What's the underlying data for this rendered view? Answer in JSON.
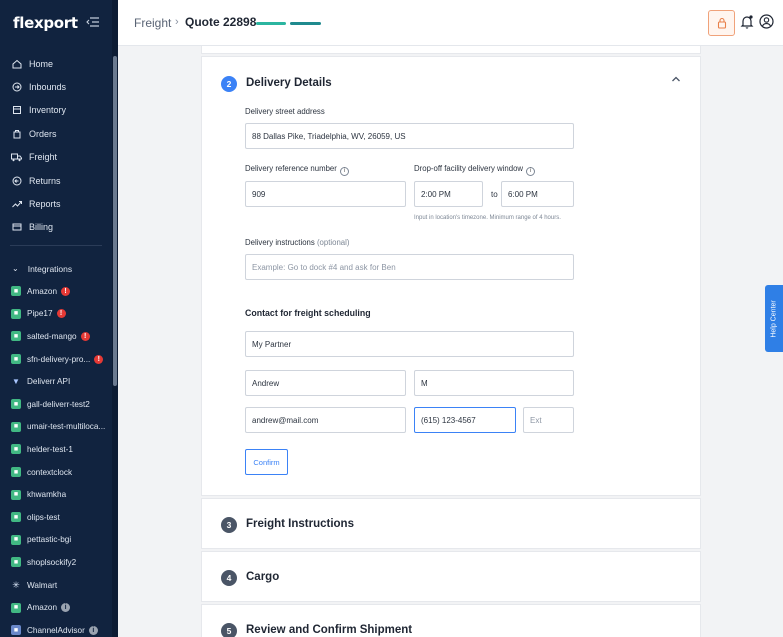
{
  "app": {
    "logo": "flexport"
  },
  "colors": {
    "sidebar": "#11233f",
    "accent": "#3b82f6",
    "progress": "#2bb5a0",
    "error": "#e53935"
  },
  "nav": {
    "items": [
      {
        "label": "Home",
        "icon": "home-icon"
      },
      {
        "label": "Inbounds",
        "icon": "inbound-icon"
      },
      {
        "label": "Inventory",
        "icon": "inventory-icon"
      },
      {
        "label": "Orders",
        "icon": "orders-icon"
      },
      {
        "label": "Freight",
        "icon": "truck-icon"
      },
      {
        "label": "Returns",
        "icon": "returns-icon"
      },
      {
        "label": "Reports",
        "icon": "trend-icon"
      },
      {
        "label": "Billing",
        "icon": "billing-icon"
      }
    ]
  },
  "integrations": {
    "header": "Integrations",
    "items": [
      {
        "label": "Amazon",
        "badge": "!"
      },
      {
        "label": "Pipe17",
        "badge": "!"
      },
      {
        "label": "salted-mango",
        "badge": "!"
      },
      {
        "label": "sfn-delivery-pro...",
        "badge": "!"
      },
      {
        "label": "Deliverr API"
      },
      {
        "label": "gall-deliverr-test2"
      },
      {
        "label": "umair-test-multiloca..."
      },
      {
        "label": "helder-test-1"
      },
      {
        "label": "contextclock"
      },
      {
        "label": "khwamkha"
      },
      {
        "label": "olips-test"
      },
      {
        "label": "pettastic-bgi"
      },
      {
        "label": "shoplsockify2"
      },
      {
        "label": "Walmart"
      },
      {
        "label": "Amazon",
        "info": "i"
      },
      {
        "label": "ChannelAdvisor",
        "info": "i"
      }
    ]
  },
  "header": {
    "breadcrumb_root": "Freight",
    "separator": "›",
    "breadcrumb_current": "Quote 22898"
  },
  "delivery": {
    "step": "2",
    "title": "Delivery Details",
    "street_label": "Delivery street address",
    "street_value": "88 Dallas Pike, Triadelphia, WV, 26059, US",
    "reference_label": "Delivery reference number",
    "reference_value": "909",
    "window_label": "Drop-off facility delivery window",
    "window_start": "2:00 PM",
    "window_to": "to",
    "window_end": "6:00 PM",
    "window_hint": "Input in location's timezone. Minimum range of 4 hours.",
    "instructions_label": "Delivery instructions",
    "instructions_optional": "(optional)",
    "instructions_placeholder": "Example: Go to dock #4 and ask for Ben",
    "contact_heading": "Contact for freight scheduling",
    "company": "My Partner",
    "first_name": "Andrew",
    "last_name": "M",
    "email": "andrew@mail.com",
    "phone": "(615) 123-4567",
    "ext_placeholder": "Ext",
    "confirm_label": "Confirm"
  },
  "steps": [
    {
      "number": "3",
      "title": "Freight Instructions"
    },
    {
      "number": "4",
      "title": "Cargo"
    },
    {
      "number": "5",
      "title": "Review and Confirm Shipment"
    }
  ],
  "help": {
    "label": "Help Center"
  }
}
